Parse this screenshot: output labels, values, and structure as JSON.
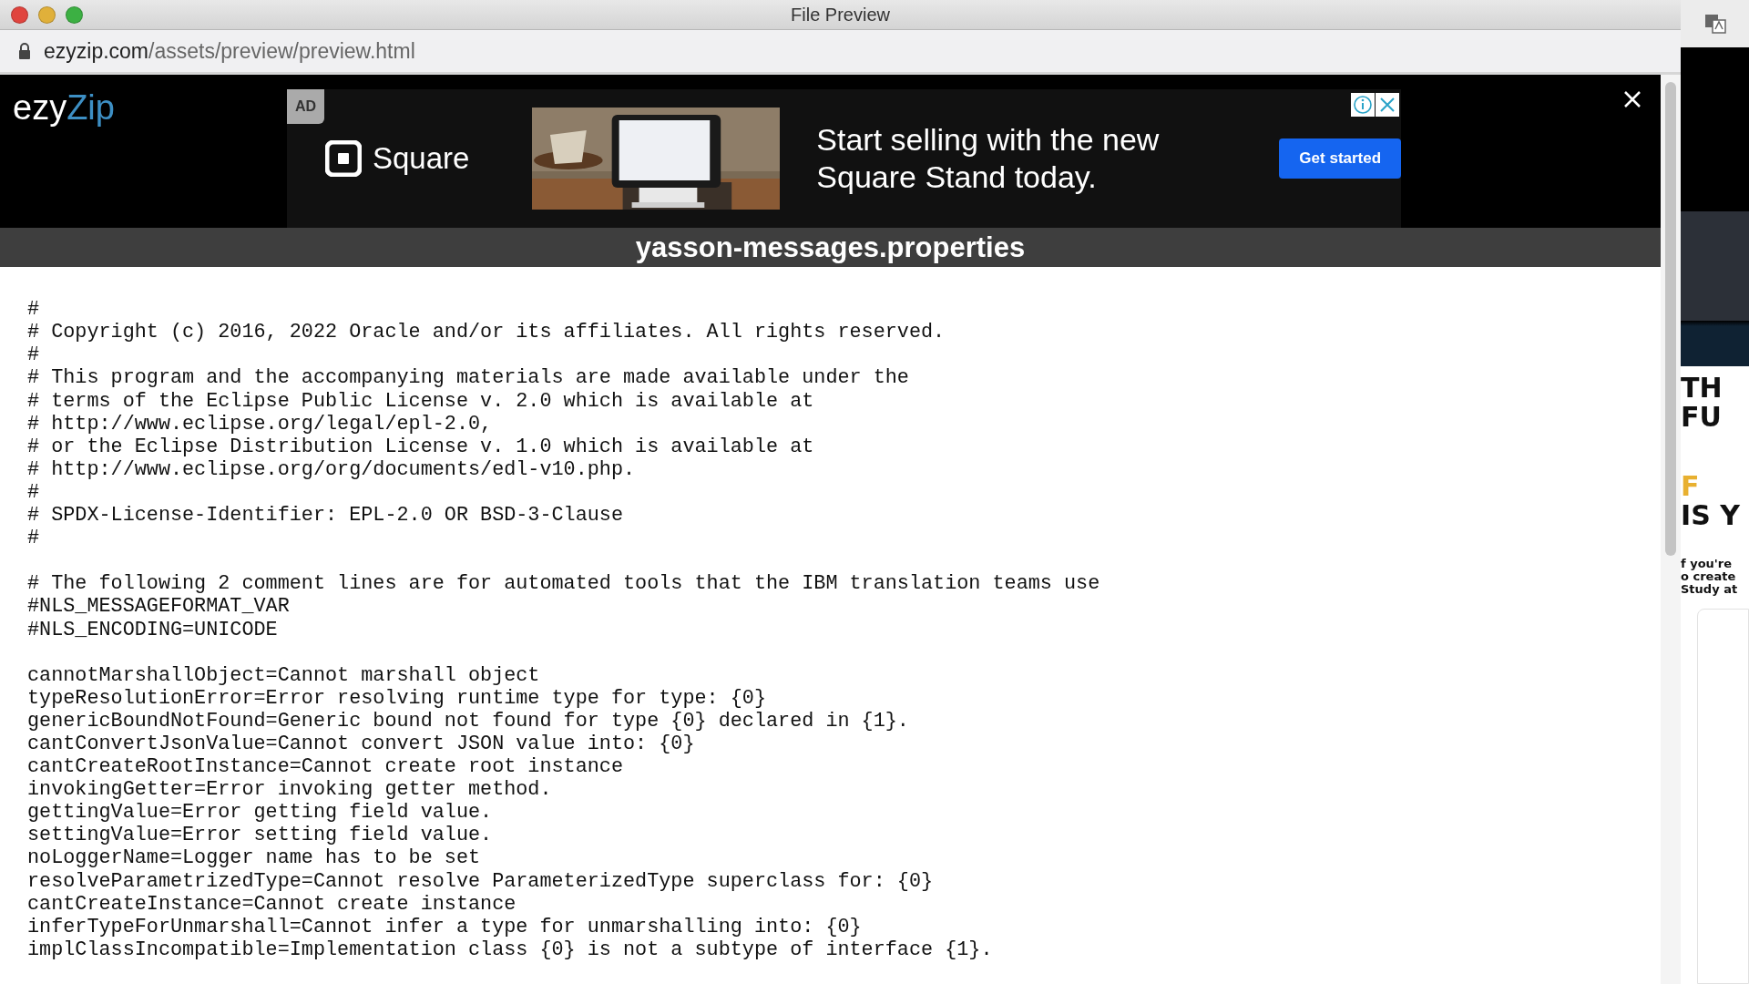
{
  "window": {
    "title": "File Preview"
  },
  "address_bar": {
    "domain": "ezyzip.com",
    "path": "/assets/preview/preview.html"
  },
  "header": {
    "logo_first": "ezy",
    "logo_second": "Zip"
  },
  "ad": {
    "badge": "AD",
    "brand": "Square",
    "headline_lines": [
      "Start selling with the new",
      "Square Stand today."
    ],
    "button": "Get started"
  },
  "file": {
    "name": "yasson-messages.properties",
    "blocks": [
      [
        "#",
        "# Copyright (c) 2016, 2022 Oracle and/or its affiliates. All rights reserved.",
        "#",
        "# This program and the accompanying materials are made available under the",
        "# terms of the Eclipse Public License v. 2.0 which is available at",
        "# http://www.eclipse.org/legal/epl-2.0,",
        "# or the Eclipse Distribution License v. 1.0 which is available at",
        "# http://www.eclipse.org/org/documents/edl-v10.php.",
        "#",
        "# SPDX-License-Identifier: EPL-2.0 OR BSD-3-Clause",
        "#"
      ],
      [
        "# The following 2 comment lines are for automated tools that the IBM translation teams use",
        "#NLS_MESSAGEFORMAT_VAR",
        "#NLS_ENCODING=UNICODE"
      ],
      [
        "cannotMarshallObject=Cannot marshall object",
        "typeResolutionError=Error resolving runtime type for type: {0}",
        "genericBoundNotFound=Generic bound not found for type {0} declared in {1}.",
        "cantConvertJsonValue=Cannot convert JSON value into: {0}",
        "cantCreateRootInstance=Cannot create root instance",
        "invokingGetter=Error invoking getter method.",
        "gettingValue=Error getting field value.",
        "settingValue=Error setting field value.",
        "noLoggerName=Logger name has to be set",
        "resolveParametrizedType=Cannot resolve ParameterizedType superclass for: {0}",
        "cantCreateInstance=Cannot create instance",
        "inferTypeForUnmarshall=Cannot infer a type for unmarshalling into: {0}",
        "implClassIncompatible=Implementation class {0} is not a subtype of interface {1}."
      ]
    ]
  },
  "side_page": {
    "headline": [
      {
        "text": "TH",
        "color": "#111111"
      },
      {
        "text": "FU",
        "color": "#111111"
      },
      {
        "text": "F",
        "color": "#e8b030"
      },
      {
        "text": "IS Y",
        "color": "#111111"
      }
    ],
    "body": [
      "f you're",
      "o create",
      "Study at"
    ]
  }
}
